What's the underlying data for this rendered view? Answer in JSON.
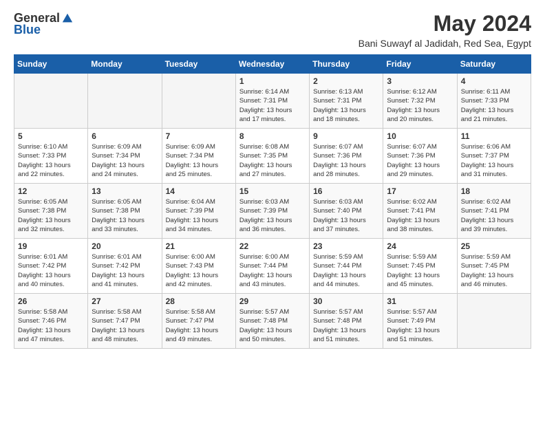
{
  "logo": {
    "general": "General",
    "blue": "Blue"
  },
  "title": {
    "month_year": "May 2024",
    "location": "Bani Suwayf al Jadidah, Red Sea, Egypt"
  },
  "weekdays": [
    "Sunday",
    "Monday",
    "Tuesday",
    "Wednesday",
    "Thursday",
    "Friday",
    "Saturday"
  ],
  "weeks": [
    [
      {
        "day": "",
        "info": ""
      },
      {
        "day": "",
        "info": ""
      },
      {
        "day": "",
        "info": ""
      },
      {
        "day": "1",
        "info": "Sunrise: 6:14 AM\nSunset: 7:31 PM\nDaylight: 13 hours\nand 17 minutes."
      },
      {
        "day": "2",
        "info": "Sunrise: 6:13 AM\nSunset: 7:31 PM\nDaylight: 13 hours\nand 18 minutes."
      },
      {
        "day": "3",
        "info": "Sunrise: 6:12 AM\nSunset: 7:32 PM\nDaylight: 13 hours\nand 20 minutes."
      },
      {
        "day": "4",
        "info": "Sunrise: 6:11 AM\nSunset: 7:33 PM\nDaylight: 13 hours\nand 21 minutes."
      }
    ],
    [
      {
        "day": "5",
        "info": "Sunrise: 6:10 AM\nSunset: 7:33 PM\nDaylight: 13 hours\nand 22 minutes."
      },
      {
        "day": "6",
        "info": "Sunrise: 6:09 AM\nSunset: 7:34 PM\nDaylight: 13 hours\nand 24 minutes."
      },
      {
        "day": "7",
        "info": "Sunrise: 6:09 AM\nSunset: 7:34 PM\nDaylight: 13 hours\nand 25 minutes."
      },
      {
        "day": "8",
        "info": "Sunrise: 6:08 AM\nSunset: 7:35 PM\nDaylight: 13 hours\nand 27 minutes."
      },
      {
        "day": "9",
        "info": "Sunrise: 6:07 AM\nSunset: 7:36 PM\nDaylight: 13 hours\nand 28 minutes."
      },
      {
        "day": "10",
        "info": "Sunrise: 6:07 AM\nSunset: 7:36 PM\nDaylight: 13 hours\nand 29 minutes."
      },
      {
        "day": "11",
        "info": "Sunrise: 6:06 AM\nSunset: 7:37 PM\nDaylight: 13 hours\nand 31 minutes."
      }
    ],
    [
      {
        "day": "12",
        "info": "Sunrise: 6:05 AM\nSunset: 7:38 PM\nDaylight: 13 hours\nand 32 minutes."
      },
      {
        "day": "13",
        "info": "Sunrise: 6:05 AM\nSunset: 7:38 PM\nDaylight: 13 hours\nand 33 minutes."
      },
      {
        "day": "14",
        "info": "Sunrise: 6:04 AM\nSunset: 7:39 PM\nDaylight: 13 hours\nand 34 minutes."
      },
      {
        "day": "15",
        "info": "Sunrise: 6:03 AM\nSunset: 7:39 PM\nDaylight: 13 hours\nand 36 minutes."
      },
      {
        "day": "16",
        "info": "Sunrise: 6:03 AM\nSunset: 7:40 PM\nDaylight: 13 hours\nand 37 minutes."
      },
      {
        "day": "17",
        "info": "Sunrise: 6:02 AM\nSunset: 7:41 PM\nDaylight: 13 hours\nand 38 minutes."
      },
      {
        "day": "18",
        "info": "Sunrise: 6:02 AM\nSunset: 7:41 PM\nDaylight: 13 hours\nand 39 minutes."
      }
    ],
    [
      {
        "day": "19",
        "info": "Sunrise: 6:01 AM\nSunset: 7:42 PM\nDaylight: 13 hours\nand 40 minutes."
      },
      {
        "day": "20",
        "info": "Sunrise: 6:01 AM\nSunset: 7:42 PM\nDaylight: 13 hours\nand 41 minutes."
      },
      {
        "day": "21",
        "info": "Sunrise: 6:00 AM\nSunset: 7:43 PM\nDaylight: 13 hours\nand 42 minutes."
      },
      {
        "day": "22",
        "info": "Sunrise: 6:00 AM\nSunset: 7:44 PM\nDaylight: 13 hours\nand 43 minutes."
      },
      {
        "day": "23",
        "info": "Sunrise: 5:59 AM\nSunset: 7:44 PM\nDaylight: 13 hours\nand 44 minutes."
      },
      {
        "day": "24",
        "info": "Sunrise: 5:59 AM\nSunset: 7:45 PM\nDaylight: 13 hours\nand 45 minutes."
      },
      {
        "day": "25",
        "info": "Sunrise: 5:59 AM\nSunset: 7:45 PM\nDaylight: 13 hours\nand 46 minutes."
      }
    ],
    [
      {
        "day": "26",
        "info": "Sunrise: 5:58 AM\nSunset: 7:46 PM\nDaylight: 13 hours\nand 47 minutes."
      },
      {
        "day": "27",
        "info": "Sunrise: 5:58 AM\nSunset: 7:47 PM\nDaylight: 13 hours\nand 48 minutes."
      },
      {
        "day": "28",
        "info": "Sunrise: 5:58 AM\nSunset: 7:47 PM\nDaylight: 13 hours\nand 49 minutes."
      },
      {
        "day": "29",
        "info": "Sunrise: 5:57 AM\nSunset: 7:48 PM\nDaylight: 13 hours\nand 50 minutes."
      },
      {
        "day": "30",
        "info": "Sunrise: 5:57 AM\nSunset: 7:48 PM\nDaylight: 13 hours\nand 51 minutes."
      },
      {
        "day": "31",
        "info": "Sunrise: 5:57 AM\nSunset: 7:49 PM\nDaylight: 13 hours\nand 51 minutes."
      },
      {
        "day": "",
        "info": ""
      }
    ]
  ]
}
